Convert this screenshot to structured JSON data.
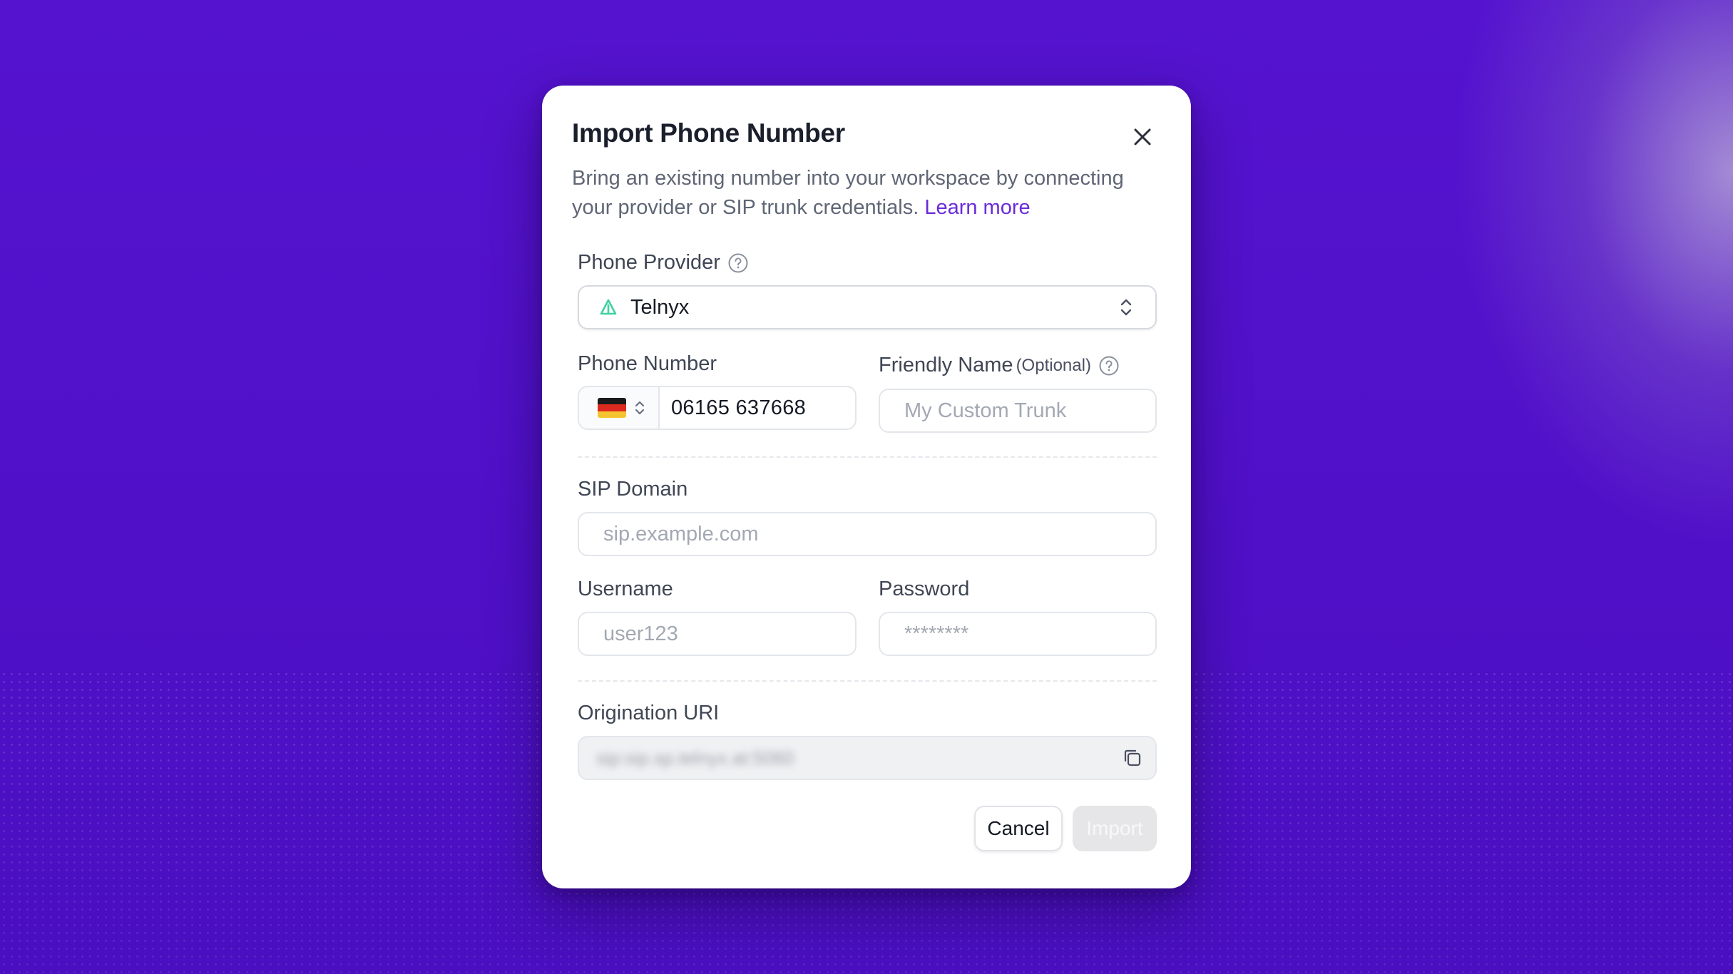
{
  "dialog": {
    "title": "Import Phone Number",
    "description": "Bring an existing number into your workspace by connecting your provider or SIP trunk credentials.",
    "learn_more": "Learn more"
  },
  "provider": {
    "label": "Phone Provider",
    "value": "Telnyx",
    "logo_icon": "telnyx-logo-icon",
    "accent": "#3fd1a2"
  },
  "phone_number": {
    "label": "Phone Number",
    "country_flag": "germany-flag-icon",
    "value": "06165 637668"
  },
  "friendly_name": {
    "label": "Friendly Name",
    "optional": "(Optional)",
    "placeholder": "My Custom Trunk"
  },
  "sip_domain": {
    "label": "SIP Domain",
    "placeholder": "sip.example.com"
  },
  "username": {
    "label": "Username",
    "placeholder": "user123"
  },
  "password": {
    "label": "Password",
    "placeholder": "********"
  },
  "origination_uri": {
    "label": "Origination URI",
    "value": "sip:sip.sp.telnyx.at:5060"
  },
  "actions": {
    "cancel": "Cancel",
    "import": "Import"
  },
  "colors": {
    "background": "#5312cc",
    "link": "#6b2bd9"
  }
}
